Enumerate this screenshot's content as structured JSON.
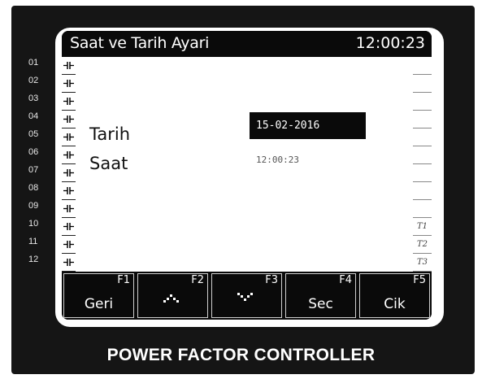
{
  "header": {
    "title": "Saat ve Tarih Ayari",
    "clock": "12:00:23"
  },
  "row_numbers": [
    "01",
    "02",
    "03",
    "04",
    "05",
    "06",
    "07",
    "08",
    "09",
    "10",
    "11",
    "12"
  ],
  "right_strip": [
    "",
    "",
    "",
    "",
    "",
    "",
    "",
    "",
    "",
    "T1",
    "T2",
    "T3"
  ],
  "fields": {
    "date": {
      "label": "Tarih",
      "value": "15-02-2016"
    },
    "time": {
      "label": "Saat",
      "value": "12:00:23"
    }
  },
  "fkeys": [
    {
      "num": "F1",
      "label": "Geri",
      "icon": null
    },
    {
      "num": "F2",
      "label": "",
      "icon": "arrow-up-icon"
    },
    {
      "num": "F3",
      "label": "",
      "icon": "arrow-down-icon"
    },
    {
      "num": "F4",
      "label": "Sec",
      "icon": null
    },
    {
      "num": "F5",
      "label": "Cik",
      "icon": null
    }
  ],
  "footer": {
    "text": "POWER FACTOR CONTROLLER"
  },
  "colors": {
    "lcd": "#0a0a0a",
    "screen": "#ffffff",
    "device": "#151515"
  }
}
